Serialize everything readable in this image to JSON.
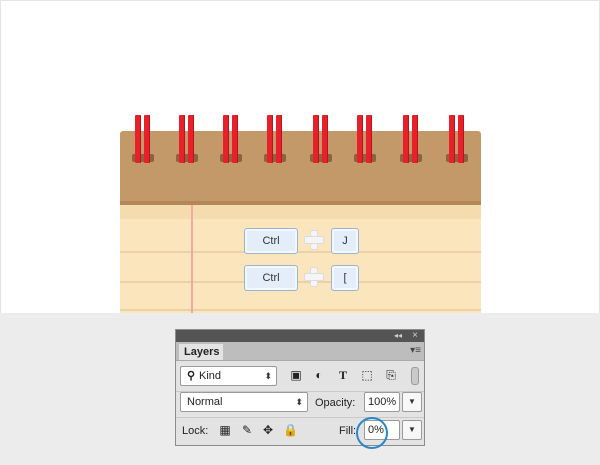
{
  "keys": [
    {
      "modifier": "Ctrl",
      "key": "J"
    },
    {
      "modifier": "Ctrl",
      "key": "["
    }
  ],
  "panel": {
    "tab_label": "Layers",
    "collapse_icon": "double-chevron-icon",
    "close_icon": "close-icon",
    "menu_icon": "panel-menu-icon",
    "filter": {
      "kind_label": "Kind",
      "icons": [
        "image-filter-icon",
        "adjustment-filter-icon",
        "type-filter-icon",
        "shape-filter-icon",
        "smart-object-filter-icon"
      ]
    },
    "blend_mode": "Normal",
    "opacity_label": "Opacity:",
    "opacity_value": "100%",
    "lock_label": "Lock:",
    "lock_icons": [
      "lock-transparent-icon",
      "lock-paint-icon",
      "lock-move-icon",
      "lock-all-icon"
    ],
    "fill_label": "Fill:",
    "fill_value": "0%"
  },
  "colors": {
    "ring": "#e8202a",
    "notepad_top": "#c4996a",
    "paper": "#fbe5bc",
    "key_fill": "#e4eefa",
    "highlight_circle": "#2b87c8"
  }
}
